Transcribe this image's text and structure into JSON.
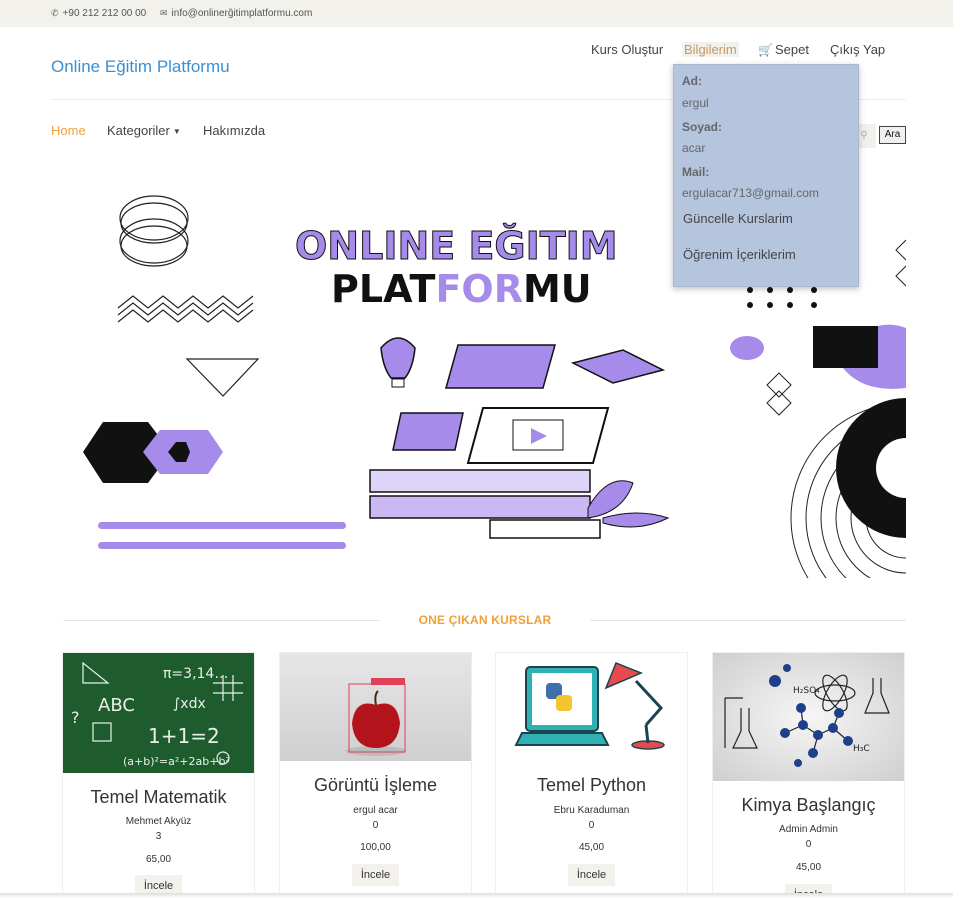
{
  "topbar": {
    "phone": "+90 212 212 00 00",
    "email": "info@onlinerğitimplatformu.com",
    "phone_icon": "phone-icon",
    "email_icon": "envelope-icon"
  },
  "header": {
    "brand": "Online Eğitim Platformu",
    "user_nav": {
      "create_course": "Kurs Oluştur",
      "my_info": "Bilgilerim",
      "cart": "Sepet",
      "logout": "Çıkış Yap"
    }
  },
  "nav": {
    "home": "Home",
    "categories": "Kategoriler",
    "about": "Hakımızda",
    "search_button": "Ara"
  },
  "dropdown": {
    "first_name_label": "Ad:",
    "first_name": "ergul",
    "last_name_label": "Soyad:",
    "last_name": "acar",
    "mail_label": "Mail:",
    "mail": "ergulacar713@gmail.com",
    "update_courses": "Güncelle Kurslarim",
    "learning_contents": "Öğrenim İçeriklerim"
  },
  "banner": {
    "line1_a": "ONLINE ",
    "line1_b": "EĞITIM",
    "line2_a": "PLAT",
    "line2_b": "FOR",
    "line2_c": "MU"
  },
  "featured": {
    "title": "ONE ÇIKAN KURSLAR",
    "courses": [
      {
        "title": "Temel Matematik",
        "instructor": "Mehmet Akyüz",
        "count": "3",
        "price": "65,00",
        "button": "İncele"
      },
      {
        "title": "Görüntü İşleme",
        "instructor": "ergul acar",
        "count": "0",
        "price": "100,00",
        "button": "İncele"
      },
      {
        "title": "Temel Python",
        "instructor": "Ebru Karaduman",
        "count": "0",
        "price": "45,00",
        "button": "İncele"
      },
      {
        "title": "Kimya Başlangıç",
        "instructor": "Admin Admin",
        "count": "0",
        "price": "45,00",
        "button": "İncele"
      }
    ]
  },
  "colors": {
    "accent": "#f0a03a",
    "brand": "#3b8fd1",
    "purple": "#a78bea",
    "dropdown_bg": "#b5c5de"
  }
}
